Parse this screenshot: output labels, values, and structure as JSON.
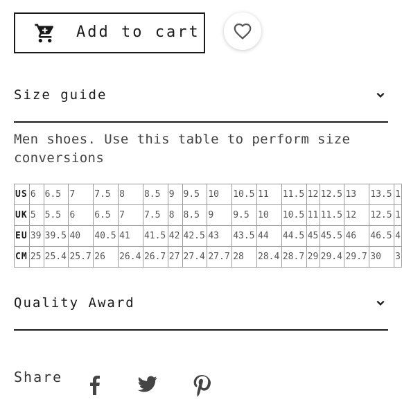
{
  "cart": {
    "label": "Add to cart",
    "icon": "shopping-cart-icon"
  },
  "wishlist": {
    "icon": "heart-outline-icon"
  },
  "size_guide": {
    "title": "Size guide",
    "description": "Men shoes. Use this table to perform size conversions",
    "table": {
      "rows": [
        {
          "label": "US",
          "values": [
            "6",
            "6.5",
            "7",
            "7.5",
            "8",
            "8.5",
            "9",
            "9.5",
            "10",
            "10.5",
            "11",
            "11.5",
            "12",
            "12.5",
            "13",
            "13.5",
            "1"
          ]
        },
        {
          "label": "UK",
          "values": [
            "5",
            "5.5",
            "6",
            "6.5",
            "7",
            "7.5",
            "8",
            "8.5",
            "9",
            "9.5",
            "10",
            "10.5",
            "11",
            "11.5",
            "12",
            "12.5",
            "1"
          ]
        },
        {
          "label": "EU",
          "values": [
            "39",
            "39.5",
            "40",
            "40.5",
            "41",
            "41.5",
            "42",
            "42.5",
            "43",
            "43.5",
            "44",
            "44.5",
            "45",
            "45.5",
            "46",
            "46.5",
            "4"
          ]
        },
        {
          "label": "CM",
          "values": [
            "25",
            "25.4",
            "25.7",
            "26",
            "26.4",
            "26.7",
            "27",
            "27.4",
            "27.7",
            "28",
            "28.4",
            "28.7",
            "29",
            "29.4",
            "29.7",
            "30",
            "3"
          ]
        }
      ]
    }
  },
  "quality": {
    "title": "Quality Award"
  },
  "share": {
    "label": "Share",
    "networks": [
      {
        "name": "facebook",
        "icon": "facebook-icon"
      },
      {
        "name": "twitter",
        "icon": "twitter-icon"
      },
      {
        "name": "pinterest",
        "icon": "pinterest-icon"
      }
    ]
  },
  "colors": {
    "text": "#1a1a1a",
    "border": "#999999"
  }
}
